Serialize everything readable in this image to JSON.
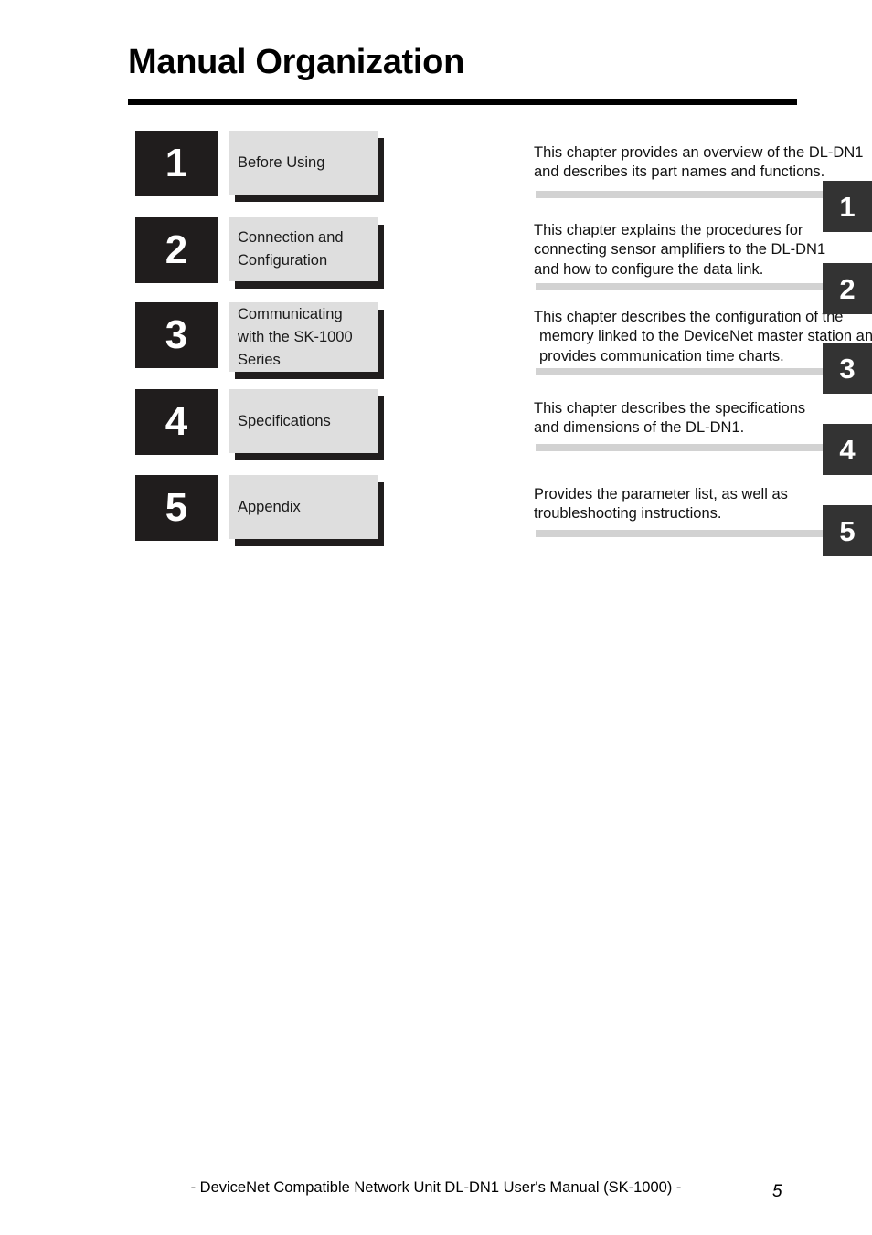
{
  "page": {
    "title": "Manual Organization",
    "footer_note": "- DeviceNet Compatible Network Unit DL-DN1 User's Manual (SK-1000) -",
    "page_number": "5"
  },
  "chapters": [
    {
      "number": "1",
      "title_lines": [
        "Before Using"
      ],
      "description_lines": [
        "This chapter provides an overview of the DL-DN1",
        "and describes its part names and functions."
      ]
    },
    {
      "number": "2",
      "title_lines": [
        "Connection and",
        "Configuration"
      ],
      "description_lines": [
        "This chapter explains the procedures for",
        "connecting sensor amplifiers to the DL-DN1",
        "and how to configure the data link."
      ]
    },
    {
      "number": "3",
      "title_lines": [
        "Communicating",
        "with the SK-1000",
        "Series"
      ],
      "description_lines": [
        "This chapter describes the configuration of the",
        "memory linked to the DeviceNet master station and",
        "provides communication time charts."
      ]
    },
    {
      "number": "4",
      "title_lines": [
        "Specifications"
      ],
      "description_lines": [
        "This chapter describes the specifications",
        "and dimensions of the DL-DN1."
      ]
    },
    {
      "number": "5",
      "title_lines": [
        "Appendix"
      ],
      "description_lines": [
        "Provides the parameter list, as well as",
        "troubleshooting instructions."
      ]
    }
  ],
  "side_tabs": [
    "1",
    "2",
    "3",
    "4",
    "5"
  ],
  "colors": {
    "number_box": "#201d1d",
    "title_box": "#dedede",
    "side_tab": "#333333",
    "rule": "#000000"
  }
}
